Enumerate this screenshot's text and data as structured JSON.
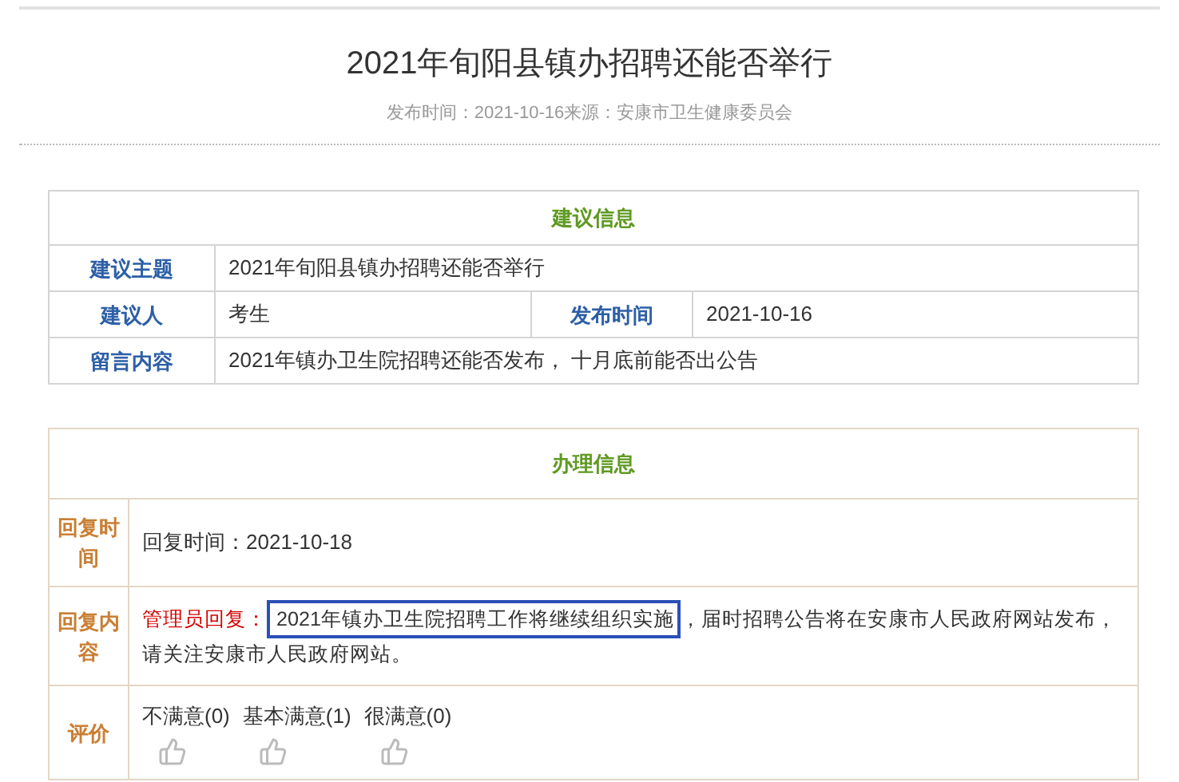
{
  "article": {
    "title": "2021年旬阳县镇办招聘还能否举行",
    "meta": "发布时间：2021-10-16来源：安康市卫生健康委员会"
  },
  "suggestion": {
    "heading": "建议信息",
    "subject_label": "建议主题",
    "subject": "2021年旬阳县镇办招聘还能否举行",
    "author_label": "建议人",
    "author": "考生",
    "date_label": "发布时间",
    "date": "2021-10-16",
    "message_label": "留言内容",
    "message": "2021年镇办卫生院招聘还能否发布， 十月底前能否出公告"
  },
  "handling": {
    "heading": "办理信息",
    "reply_time_label": "回复时间",
    "reply_time": "回复时间：2021-10-18",
    "reply_label": "回复内容",
    "reply_admin": "管理员回复：",
    "reply_highlighted": "2021年镇办卫生院招聘工作将继续组织实施",
    "reply_rest": "，届时招聘公告将在安康市人民政府网站发布，请关注安康市人民政府网站。",
    "rating_label": "评价",
    "ratings": [
      {
        "label": "不满意(0)"
      },
      {
        "label": "基本满意(1)"
      },
      {
        "label": "很满意(0)"
      }
    ]
  }
}
